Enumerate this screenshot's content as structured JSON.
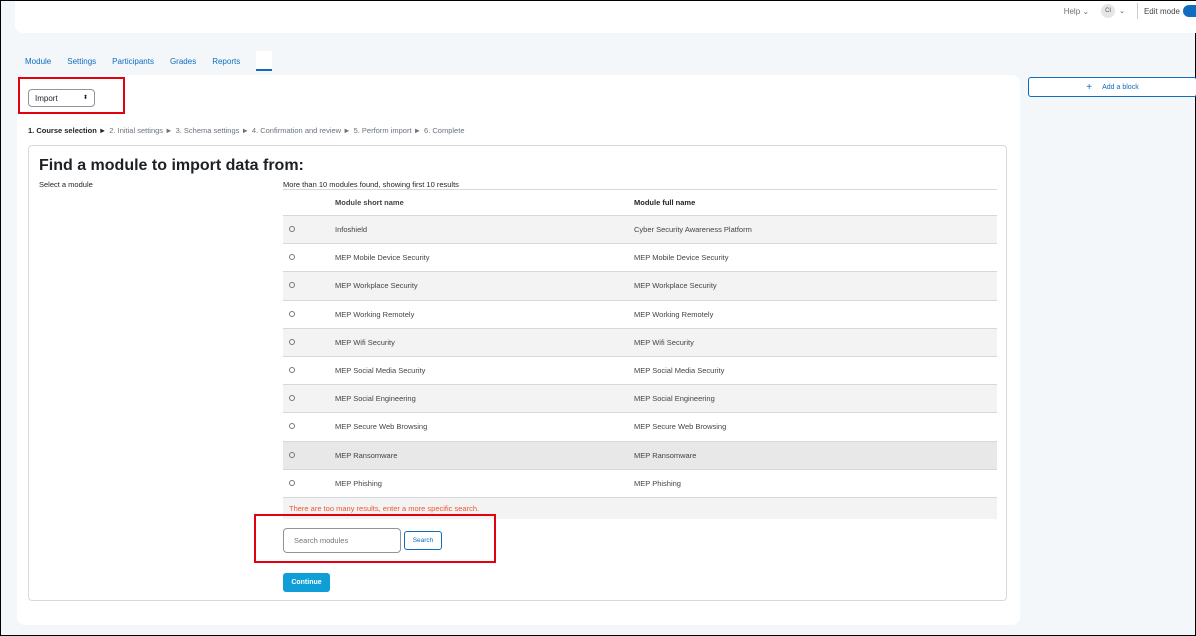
{
  "header": {
    "help_label": "Help",
    "help_chevron": "⌄",
    "avatar_initials": "CI",
    "user_chevron": "⌄",
    "edit_mode_label": "Edit mode"
  },
  "tabs": [
    {
      "label": "Module"
    },
    {
      "label": "Settings"
    },
    {
      "label": "Participants"
    },
    {
      "label": "Grades"
    },
    {
      "label": "Reports"
    }
  ],
  "import_select": {
    "value": "Import",
    "arrows": "⬍"
  },
  "steps": [
    "1. Course selection ►",
    "2. Initial settings ►",
    "3. Schema settings ►",
    "4. Confirmation and review ►",
    "5. Perform import ►",
    "6. Complete"
  ],
  "panel": {
    "title": "Find a module to import data from:",
    "select_label": "Select a module",
    "found_message": "More than 10 modules found, showing first 10 results"
  },
  "table": {
    "headers": {
      "short": "Module short name",
      "full": "Module full name"
    },
    "rows": [
      {
        "short": "Infoshield",
        "full": "Cyber Security Awareness Platform"
      },
      {
        "short": "MEP Mobile Device Security",
        "full": "MEP Mobile Device Security"
      },
      {
        "short": "MEP Workplace Security",
        "full": "MEP Workplace Security"
      },
      {
        "short": "MEP Working Remotely",
        "full": "MEP Working Remotely"
      },
      {
        "short": "MEP Wifi Security",
        "full": "MEP Wifi Security"
      },
      {
        "short": "MEP Social Media Security",
        "full": "MEP Social Media Security"
      },
      {
        "short": "MEP Social Engineering",
        "full": "MEP Social Engineering"
      },
      {
        "short": "MEP Secure Web Browsing",
        "full": "MEP Secure Web Browsing"
      },
      {
        "short": "MEP Ransomware",
        "full": "MEP Ransomware"
      },
      {
        "short": "MEP Phishing",
        "full": "MEP Phishing"
      }
    ],
    "warning": "There are too many results, enter a more specific search."
  },
  "search": {
    "placeholder": "Search modules",
    "button_label": "Search"
  },
  "continue_label": "Continue",
  "add_block": {
    "label": "Add a block",
    "icon": "+"
  }
}
